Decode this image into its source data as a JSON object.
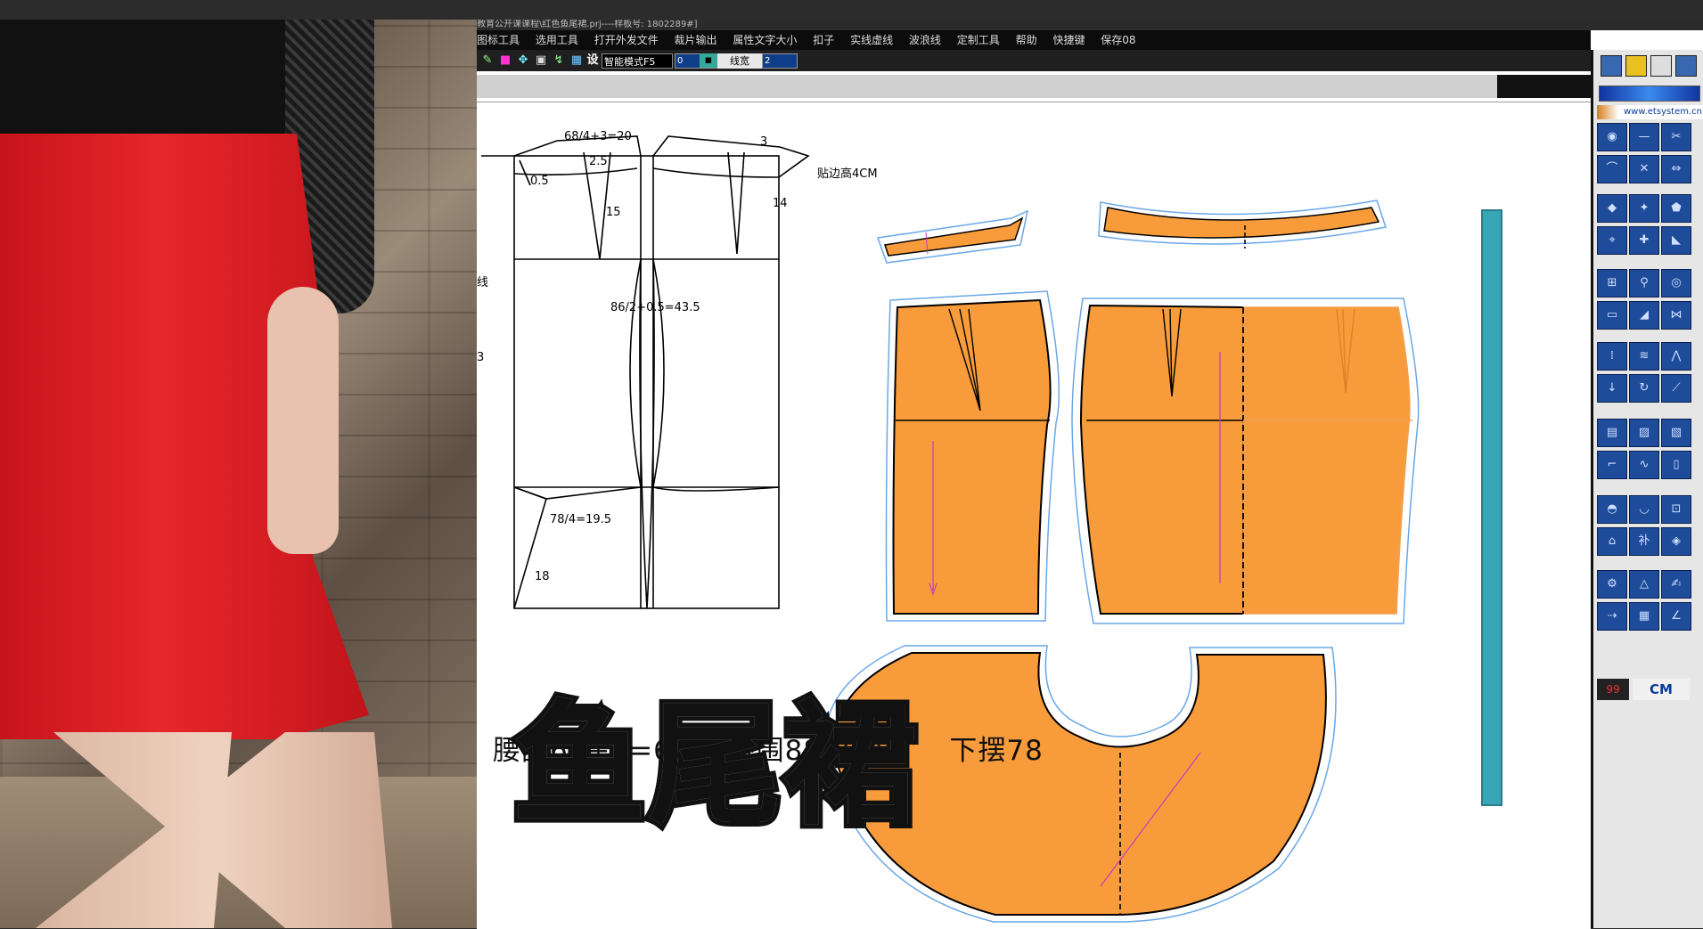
{
  "window": {
    "title": "教育公开课课程\\红色鱼尾裙.prj----样板号: 1802289#]"
  },
  "menu": {
    "items": [
      "图标工具",
      "选用工具",
      "打开外发文件",
      "裁片输出",
      "属性文字大小",
      "扣子",
      "实线虚线",
      "波浪线",
      "定制工具",
      "帮助",
      "快捷键",
      "保存08"
    ]
  },
  "toolbar": {
    "settings_label": "设",
    "mode_select": "智能模式F5",
    "value_one": "0",
    "line_width_label": "线宽",
    "line_width_value": "2"
  },
  "right_panel": {
    "url": "www.etsystem.cn",
    "counter": "99",
    "unit": "CM"
  },
  "draft": {
    "annot_waist": "68/4+3=20",
    "annot_dart1": "2.5",
    "annot_dart2": "3",
    "annot_05": "0.5",
    "annot_15": "15",
    "annot_14": "14",
    "annot_facing": "贴边高4CM",
    "annot_hip": "86/2+0.5=43.5",
    "annot_hem": "78/4=19.5",
    "annot_18": "18",
    "annot_left1": "线",
    "annot_left2": "3"
  },
  "formula": {
    "waist": "腰围66+2=68",
    "hip": "臀围88-2=86",
    "hem": "下摆78"
  },
  "overlay": {
    "title": "鱼尾裙"
  }
}
